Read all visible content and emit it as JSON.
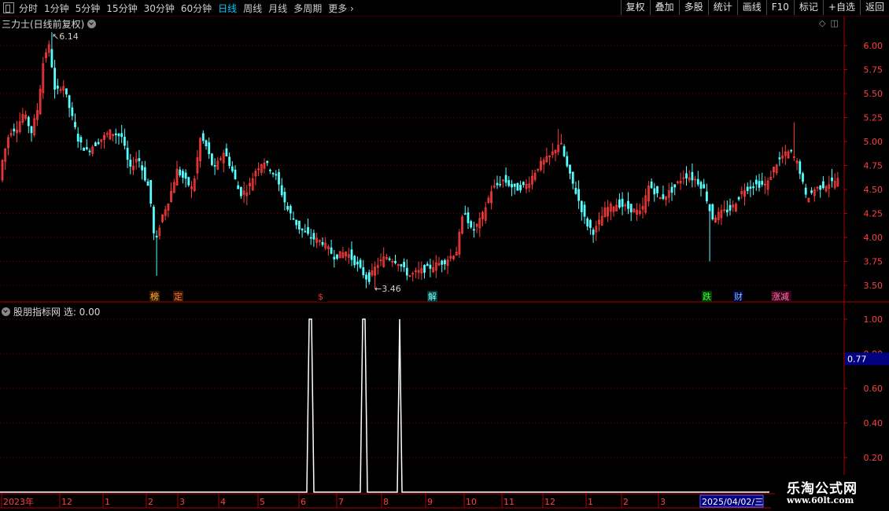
{
  "toolbar": {
    "periods": [
      "分时",
      "1分钟",
      "5分钟",
      "15分钟",
      "30分钟",
      "60分钟",
      "日线",
      "周线",
      "月线",
      "多周期",
      "更多"
    ],
    "active_period": "日线",
    "more_arrow": "›",
    "right_buttons": [
      "复权",
      "叠加",
      "多股",
      "统计",
      "画线",
      "F10",
      "标记",
      "+自选",
      "返回"
    ]
  },
  "main_panel": {
    "title": "三力士(日线前复权)",
    "high_label": "6.14",
    "low_label": "3.46"
  },
  "sub_panel": {
    "title": "股朋指标网 选: 0.00",
    "current_value": "0.77"
  },
  "date_axis": {
    "selected_date": "2025/04/02/三"
  },
  "markers": [
    "榜",
    "定",
    "$",
    "解",
    "跌",
    "财",
    "涨减"
  ],
  "watermark": {
    "line1": "乐淘公式网",
    "line2": "www.60lt.com"
  },
  "colors": {
    "up": "#ff3b3b",
    "down": "#54ffff",
    "grid": "#7a0000",
    "axis": "#b00000",
    "active_period": "#00c8ff",
    "indicator_line": "#ffffff",
    "value_box": "#000080"
  },
  "chart_data": [
    {
      "type": "candlestick",
      "title": "三力士(日线前复权)",
      "y_ticks": [
        "6.00",
        "5.75",
        "5.50",
        "5.25",
        "5.00",
        "4.75",
        "4.50",
        "4.25",
        "4.00",
        "3.75",
        "3.50"
      ],
      "ylim": [
        3.4,
        6.2
      ],
      "x_ticks": [
        "2023年",
        "12",
        "1",
        "2",
        "3",
        "4",
        "5",
        "6",
        "7",
        "8",
        "9",
        "10",
        "11",
        "12",
        "1",
        "2",
        "3"
      ],
      "high": 6.14,
      "low": 3.46,
      "trend_anchors": [
        [
          0,
          4.7
        ],
        [
          12,
          5.1
        ],
        [
          22,
          5.15
        ],
        [
          30,
          5.3
        ],
        [
          40,
          5.1
        ],
        [
          48,
          5.35
        ],
        [
          56,
          5.9
        ],
        [
          63,
          6.0
        ],
        [
          70,
          5.5
        ],
        [
          80,
          5.6
        ],
        [
          90,
          5.3
        ],
        [
          100,
          5.0
        ],
        [
          110,
          4.9
        ],
        [
          125,
          5.0
        ],
        [
          140,
          5.1
        ],
        [
          155,
          5.05
        ],
        [
          165,
          4.7
        ],
        [
          175,
          4.85
        ],
        [
          185,
          4.6
        ],
        [
          190,
          4.5
        ],
        [
          197,
          3.9
        ],
        [
          205,
          4.2
        ],
        [
          215,
          4.4
        ],
        [
          225,
          4.7
        ],
        [
          235,
          4.6
        ],
        [
          245,
          4.5
        ],
        [
          255,
          5.05
        ],
        [
          262,
          4.95
        ],
        [
          272,
          4.7
        ],
        [
          285,
          4.9
        ],
        [
          295,
          4.7
        ],
        [
          305,
          4.45
        ],
        [
          315,
          4.5
        ],
        [
          325,
          4.7
        ],
        [
          335,
          4.8
        ],
        [
          350,
          4.65
        ],
        [
          365,
          4.3
        ],
        [
          380,
          4.1
        ],
        [
          395,
          4.0
        ],
        [
          410,
          3.95
        ],
        [
          425,
          3.8
        ],
        [
          440,
          3.85
        ],
        [
          455,
          3.7
        ],
        [
          468,
          3.55
        ],
        [
          478,
          3.7
        ],
        [
          490,
          3.8
        ],
        [
          505,
          3.75
        ],
        [
          520,
          3.6
        ],
        [
          535,
          3.65
        ],
        [
          550,
          3.7
        ],
        [
          565,
          3.75
        ],
        [
          580,
          3.85
        ],
        [
          590,
          4.3
        ],
        [
          600,
          4.05
        ],
        [
          612,
          4.2
        ],
        [
          625,
          4.5
        ],
        [
          640,
          4.6
        ],
        [
          655,
          4.5
        ],
        [
          670,
          4.55
        ],
        [
          685,
          4.75
        ],
        [
          700,
          4.85
        ],
        [
          712,
          5.0
        ],
        [
          722,
          4.7
        ],
        [
          735,
          4.4
        ],
        [
          745,
          4.15
        ],
        [
          755,
          4.05
        ],
        [
          770,
          4.3
        ],
        [
          785,
          4.35
        ],
        [
          800,
          4.3
        ],
        [
          815,
          4.25
        ],
        [
          825,
          4.55
        ],
        [
          840,
          4.4
        ],
        [
          855,
          4.5
        ],
        [
          870,
          4.65
        ],
        [
          885,
          4.6
        ],
        [
          895,
          4.5
        ],
        [
          905,
          4.2
        ],
        [
          915,
          4.25
        ],
        [
          930,
          4.3
        ],
        [
          945,
          4.5
        ],
        [
          960,
          4.55
        ],
        [
          975,
          4.55
        ],
        [
          985,
          4.75
        ],
        [
          995,
          4.85
        ],
        [
          1005,
          4.9
        ],
        [
          1015,
          4.75
        ],
        [
          1025,
          4.4
        ],
        [
          1035,
          4.5
        ],
        [
          1050,
          4.55
        ],
        [
          1065,
          4.6
        ]
      ]
    },
    {
      "type": "line",
      "title": "股朋指标网 选: 0.00",
      "y_ticks": [
        "1.00",
        "0.80",
        "0.60",
        "0.40",
        "0.20"
      ],
      "ylim": [
        0,
        1.05
      ],
      "series": [
        {
          "points": [
            [
              0,
              0
            ],
            [
              390,
              0
            ],
            [
              393,
              1
            ],
            [
              396,
              1
            ],
            [
              399,
              0
            ],
            [
              458,
              0
            ],
            [
              461,
              1
            ],
            [
              464,
              1
            ],
            [
              467,
              0
            ],
            [
              505,
              0
            ],
            [
              508,
              1
            ],
            [
              511,
              0
            ],
            [
              978,
              0
            ]
          ]
        }
      ]
    }
  ]
}
